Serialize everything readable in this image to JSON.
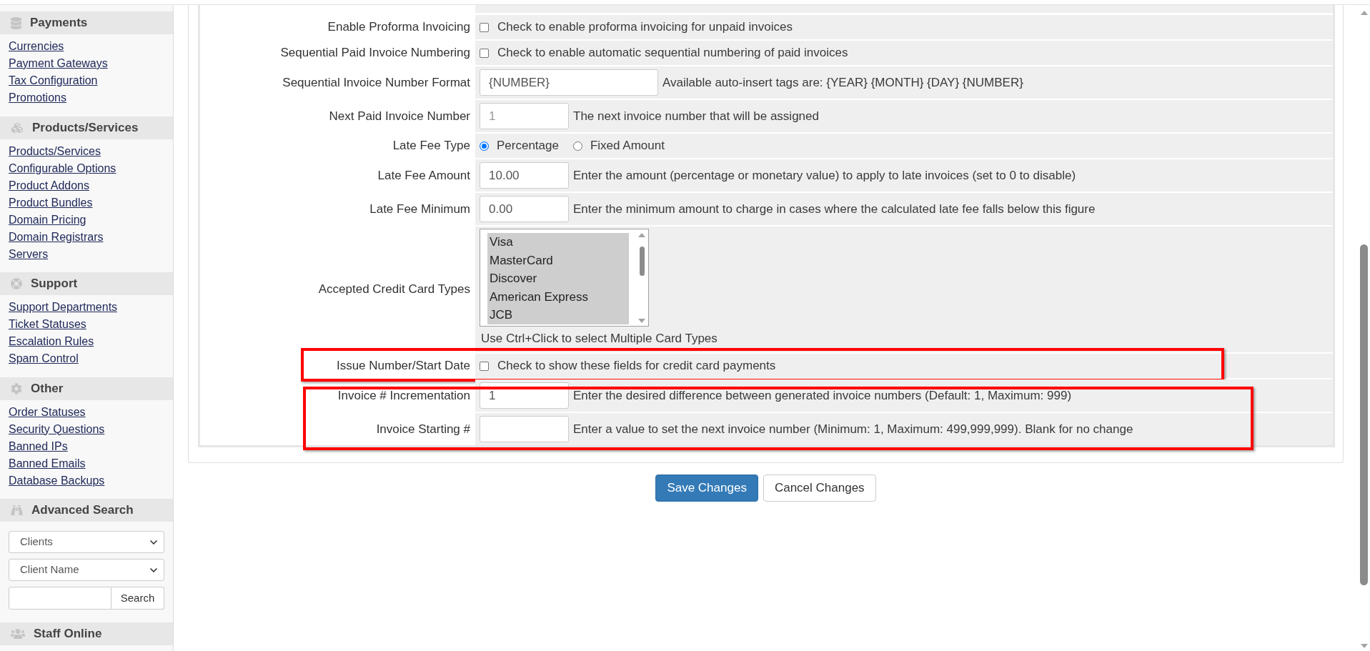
{
  "sidebar": [
    {
      "kind": "links",
      "title": "Payments",
      "links": [
        "Currencies",
        "Payment Gateways",
        "Tax Configuration",
        "Promotions"
      ]
    },
    {
      "kind": "links",
      "title": "Products/Services",
      "links": [
        "Products/Services",
        "Configurable Options",
        "Product Addons",
        "Product Bundles",
        "Domain Pricing",
        "Domain Registrars",
        "Servers"
      ]
    },
    {
      "kind": "links",
      "title": "Support",
      "links": [
        "Support Departments",
        "Ticket Statuses",
        "Escalation Rules",
        "Spam Control"
      ]
    },
    {
      "kind": "links",
      "title": "Other",
      "links": [
        "Order Statuses",
        "Security Questions",
        "Banned IPs",
        "Banned Emails",
        "Database Backups"
      ]
    },
    {
      "kind": "search",
      "title": "Advanced Search",
      "selects": [
        "Clients",
        "Client Name"
      ],
      "button": "Search"
    },
    {
      "kind": "links",
      "title": "Staff Online"
    }
  ],
  "settings": [
    {
      "highlighted": false,
      "rows": [
        {
          "kind": "checkbox",
          "label": "Enable Proforma Invoicing",
          "checked": false,
          "description": "Check to enable proforma invoicing for unpaid invoices"
        },
        {
          "kind": "checkbox",
          "label": "Sequential Paid Invoice Numbering",
          "checked": false,
          "description": "Check to enable automatic sequential numbering of paid invoices"
        },
        {
          "kind": "text",
          "label": "Sequential Invoice Number Format",
          "value": "{NUMBER}",
          "description": "Available auto-insert tags are: {YEAR} {MONTH} {DAY} {NUMBER}"
        },
        {
          "kind": "number",
          "label": "Next Paid Invoice Number",
          "placeholder": "1",
          "description": "The next invoice number that will be assigned"
        },
        {
          "kind": "radio",
          "label": "Late Fee Type",
          "options": [
            {
              "label": "Percentage",
              "selected": true
            },
            {
              "label": "Fixed Amount",
              "selected": false
            }
          ]
        },
        {
          "kind": "number",
          "label": "Late Fee Amount",
          "value": "10.00",
          "description": "Enter the amount (percentage or monetary value) to apply to late invoices (set to 0 to disable)"
        },
        {
          "kind": "number",
          "label": "Late Fee Minimum",
          "value": "0.00",
          "description": "Enter the minimum amount to charge in cases where the calculated late fee falls below this figure"
        },
        {
          "kind": "multiselect",
          "label": "Accepted Credit Card Types",
          "options": [
            {
              "label": "Visa",
              "selected": true
            },
            {
              "label": "MasterCard",
              "selected": true
            },
            {
              "label": "Discover",
              "selected": true
            },
            {
              "label": "American Express",
              "selected": true
            },
            {
              "label": "JCB",
              "selected": true
            }
          ],
          "note": "Use Ctrl+Click to select Multiple Card Types"
        }
      ]
    },
    {
      "highlighted": true,
      "rows": [
        {
          "kind": "checkbox",
          "label": "Issue Number/Start Date",
          "checked": false,
          "description": "Check to show these fields for credit card payments"
        }
      ]
    },
    {
      "highlighted": true,
      "rows": [
        {
          "kind": "number",
          "label": "Invoice # Incrementation",
          "value": "1",
          "description": "Enter the desired difference between generated invoice numbers (Default: 1, Maximum: 999)"
        },
        {
          "kind": "number",
          "label": "Invoice Starting #",
          "description": "Enter a value to set the next invoice number (Minimum: 1, Maximum: 499,999,999). Blank for no change"
        }
      ]
    }
  ],
  "buttons": [
    {
      "kind": "primary",
      "label": "Save Changes"
    },
    {
      "kind": "default",
      "label": "Cancel Changes"
    }
  ]
}
